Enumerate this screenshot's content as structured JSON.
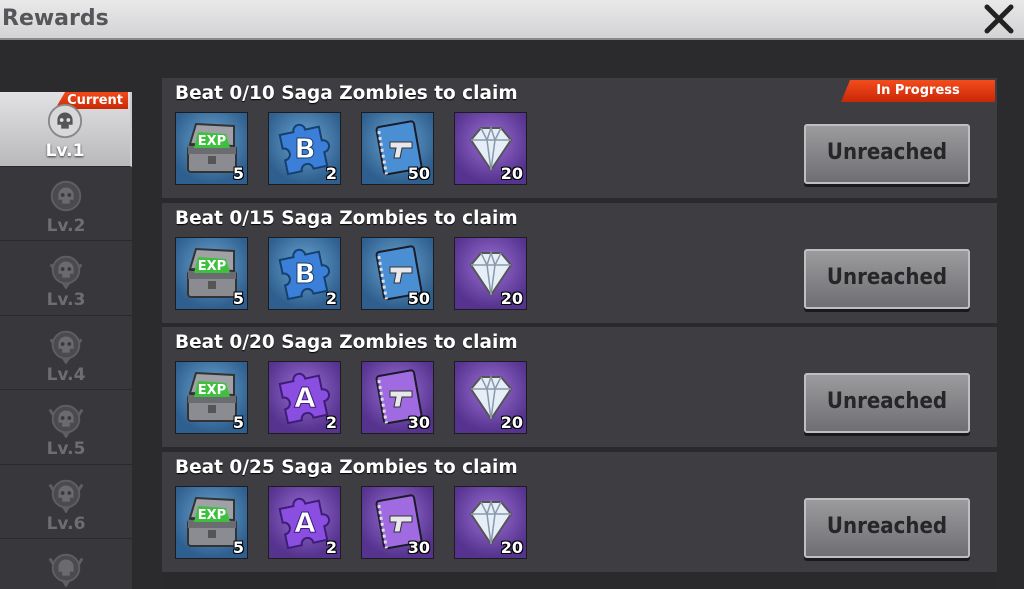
{
  "window": {
    "title": "Rewards"
  },
  "sidebar": {
    "current_badge": "Current",
    "levels": [
      "Lv.1",
      "Lv.2",
      "Lv.3",
      "Lv.4",
      "Lv.5",
      "Lv.6"
    ]
  },
  "status_badge": "In Progress",
  "missions": [
    {
      "title": "Beat 0/10 Saga Zombies to claim",
      "button": "Unreached",
      "rewards": [
        {
          "icon": "exp-chest-icon",
          "tier": "blue",
          "qty": "5"
        },
        {
          "icon": "puzzle-b-icon",
          "tier": "blue",
          "qty": "2"
        },
        {
          "icon": "weapon-manual-icon",
          "tier": "blue",
          "qty": "50"
        },
        {
          "icon": "diamond-icon",
          "tier": "purple",
          "qty": "20"
        }
      ]
    },
    {
      "title": "Beat 0/15 Saga Zombies to claim",
      "button": "Unreached",
      "rewards": [
        {
          "icon": "exp-chest-icon",
          "tier": "blue",
          "qty": "5"
        },
        {
          "icon": "puzzle-b-icon",
          "tier": "blue",
          "qty": "2"
        },
        {
          "icon": "weapon-manual-icon",
          "tier": "blue",
          "qty": "50"
        },
        {
          "icon": "diamond-icon",
          "tier": "purple",
          "qty": "20"
        }
      ]
    },
    {
      "title": "Beat 0/20 Saga Zombies to claim",
      "button": "Unreached",
      "rewards": [
        {
          "icon": "exp-chest-icon",
          "tier": "blue",
          "qty": "5"
        },
        {
          "icon": "puzzle-a-icon",
          "tier": "purple",
          "qty": "2"
        },
        {
          "icon": "weapon-manual-icon",
          "tier": "purple",
          "qty": "30"
        },
        {
          "icon": "diamond-icon",
          "tier": "purple",
          "qty": "20"
        }
      ]
    },
    {
      "title": "Beat 0/25 Saga Zombies to claim",
      "button": "Unreached",
      "rewards": [
        {
          "icon": "exp-chest-icon",
          "tier": "blue",
          "qty": "5"
        },
        {
          "icon": "puzzle-a-icon",
          "tier": "purple",
          "qty": "2"
        },
        {
          "icon": "weapon-manual-icon",
          "tier": "purple",
          "qty": "30"
        },
        {
          "icon": "diamond-icon",
          "tier": "purple",
          "qty": "20"
        }
      ]
    }
  ],
  "colors": {
    "accent": "#e03a10",
    "blue_tier": "#3f7fb3",
    "purple_tier": "#7a4dbd"
  }
}
